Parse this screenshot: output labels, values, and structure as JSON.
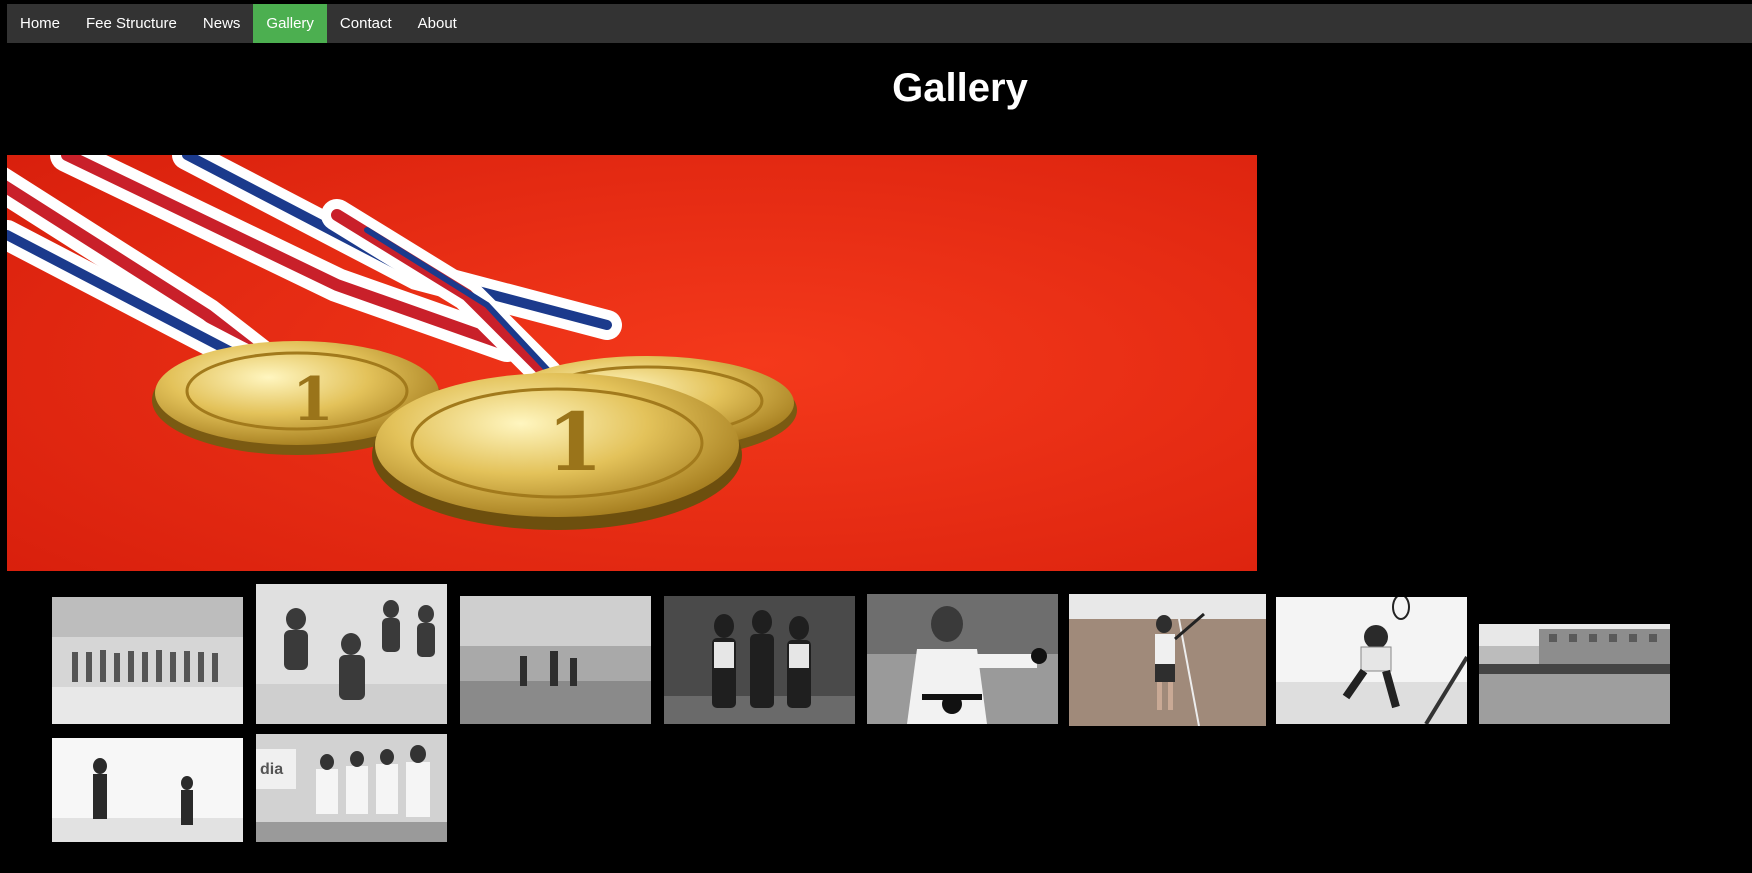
{
  "nav": {
    "items": [
      {
        "label": "Home",
        "name": "nav-home",
        "active": false
      },
      {
        "label": "Fee Structure",
        "name": "nav-fee-structure",
        "active": false
      },
      {
        "label": "News",
        "name": "nav-news",
        "active": false
      },
      {
        "label": "Gallery",
        "name": "nav-gallery",
        "active": true
      },
      {
        "label": "Contact",
        "name": "nav-contact",
        "active": false
      },
      {
        "label": "About",
        "name": "nav-about",
        "active": false
      }
    ]
  },
  "page": {
    "title": "Gallery"
  },
  "colors": {
    "nav_bg": "#333333",
    "nav_active": "#4CAF50",
    "page_bg": "#000000",
    "hero_bg": "#ef2a12"
  },
  "gallery": {
    "hero": "gold-medals-photo",
    "thumbnails": [
      "team-group-indoor-court-photo",
      "boxing-practice-photo",
      "indoor-court-drill-photo",
      "gym-trainers-photo",
      "karate-student-photo",
      "tennis-player-clay-court-photo",
      "squash-player-photo",
      "school-building-pool-photo",
      "squash-court-pair-photo",
      "shooting-range-photo"
    ]
  }
}
